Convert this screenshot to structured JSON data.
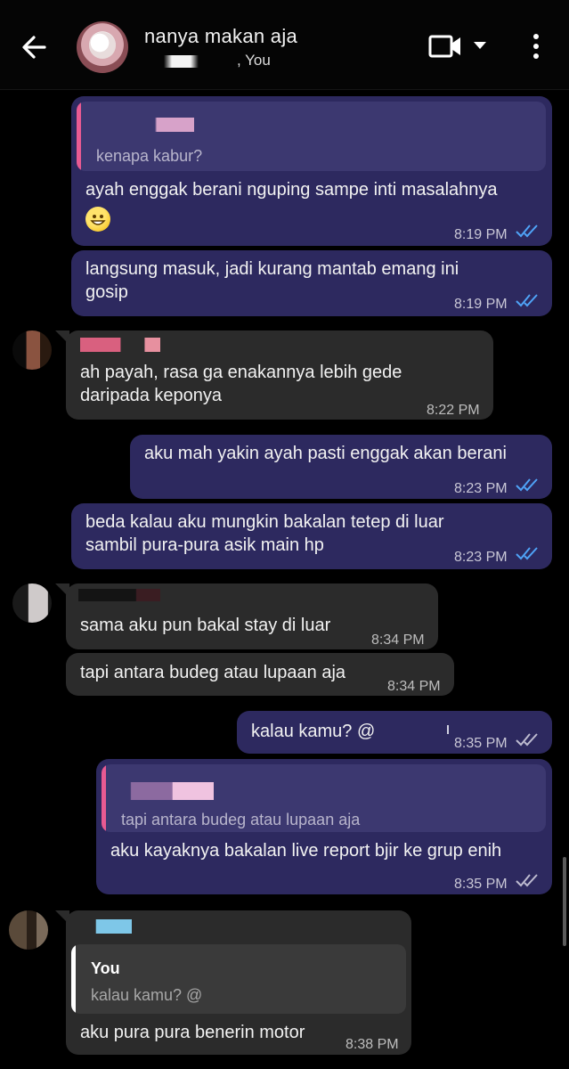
{
  "header": {
    "title": "nanya makan aja",
    "subtitle": ", You"
  },
  "messages": [
    {
      "quote": "kenapa kabur?",
      "text": "ayah enggak berani nguping sampe inti masalahnya",
      "time": "8:19 PM"
    },
    {
      "text": "langsung masuk, jadi kurang mantab emang ini\ngosip",
      "time": "8:19 PM"
    },
    {
      "text": "ah payah, rasa ga enakannya lebih gede\ndaripada keponya",
      "time": "8:22 PM"
    },
    {
      "text": "aku mah yakin ayah pasti enggak akan berani",
      "time": "8:23 PM"
    },
    {
      "text": "beda kalau aku mungkin bakalan tetep di luar\nsambil pura-pura asik main hp",
      "time": "8:23 PM"
    },
    {
      "text": "sama aku pun bakal stay di luar",
      "time": "8:34 PM"
    },
    {
      "text": "tapi antara budeg atau lupaan aja",
      "time": "8:34 PM"
    },
    {
      "text": "kalau kamu? @",
      "time": "8:35 PM"
    },
    {
      "quote": "tapi antara budeg atau lupaan aja",
      "text": "aku kayaknya bakalan live report bjir ke grup enih",
      "time": "8:35 PM"
    },
    {
      "quote_name": "You",
      "quote": "kalau kamu? @",
      "text": "aku pura pura benerin motor",
      "time": "8:38 PM"
    }
  ]
}
